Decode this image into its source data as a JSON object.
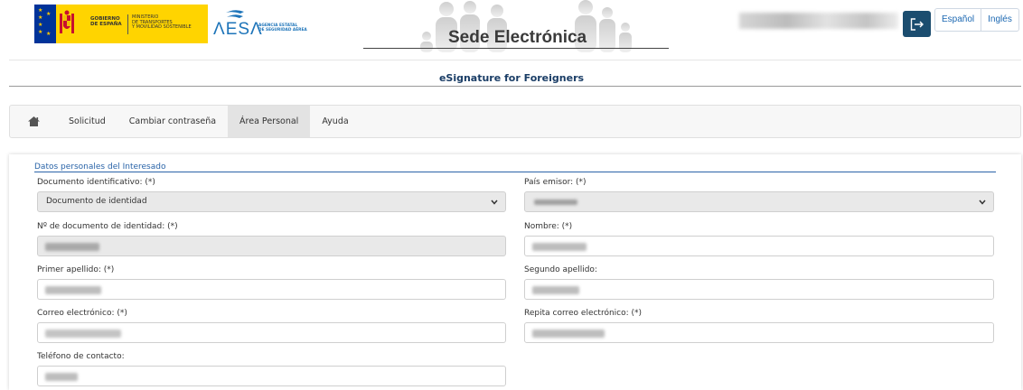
{
  "header": {
    "gov_line1": "GOBIERNO",
    "gov_line2": "DE ESPAÑA",
    "ministry_line1": "MINISTERIO",
    "ministry_line2": "DE TRANSPORTES",
    "ministry_line3": "Y MOVILIDAD SOSTENIBLE",
    "aesa_mark": "ΛESΛ",
    "aesa_sub1": "AGENCIA ESTATAL",
    "aesa_sub2": "DE SEGURIDAD AÉREA",
    "site_title": "Sede Electrónica",
    "logout_icon": "logout-icon",
    "languages": [
      "Español",
      "Inglés"
    ]
  },
  "page": {
    "title": "eSignature for Foreigners"
  },
  "nav": {
    "home_icon": "home-icon",
    "items": [
      "Solicitud",
      "Cambiar contraseña",
      "Área Personal",
      "Ayuda"
    ],
    "active": "Área Personal"
  },
  "form": {
    "legend": "Datos personales del Interesado",
    "doc_type_label": "Documento identificativo: (*)",
    "doc_type_value": "Documento de identidad",
    "country_label": "País emisor: (*)",
    "doc_number_label": "Nº de documento de identidad: (*)",
    "name_label": "Nombre: (*)",
    "surname1_label": "Primer apellido: (*)",
    "surname2_label": "Segundo apellido:",
    "email_label": "Correo electrónico: (*)",
    "email_repeat_label": "Repita correo electrónico: (*)",
    "phone_label": "Teléfono de contacto:"
  },
  "colors": {
    "accent": "#1c68b2",
    "logout_bg": "#1b4d6f",
    "gov_yellow": "#ffd400",
    "title": "#1a3d66"
  }
}
